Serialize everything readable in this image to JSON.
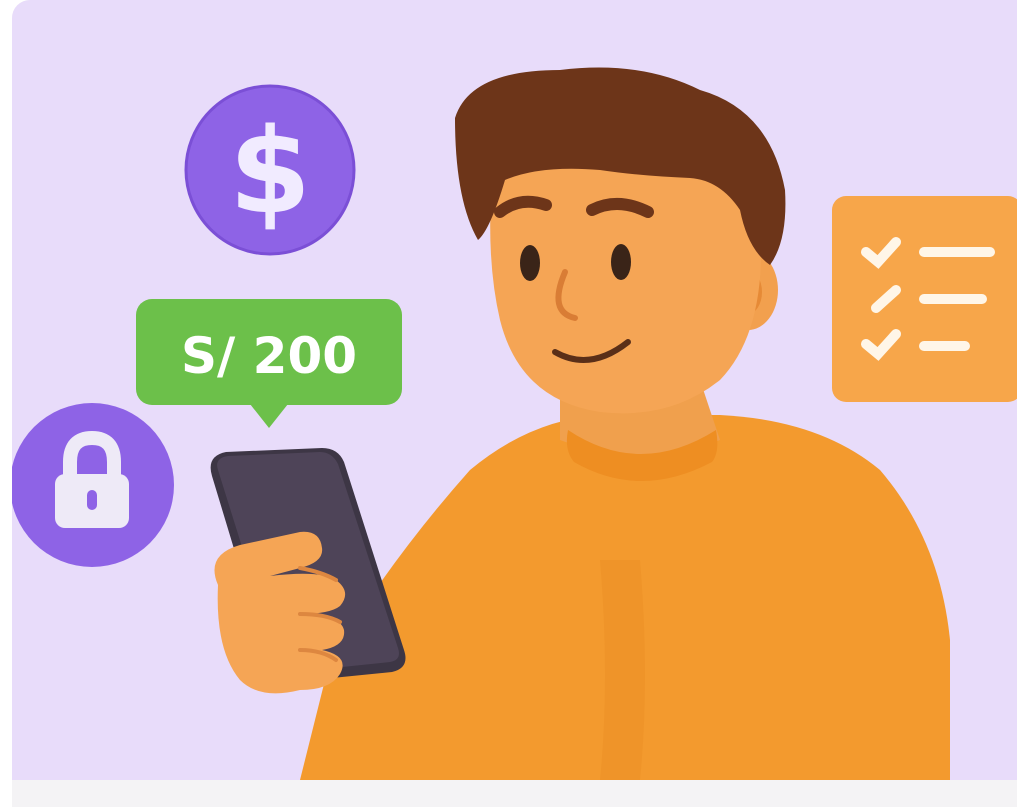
{
  "illustration": {
    "price_tag": {
      "amount": "S/ 200",
      "color": "#6cc04a"
    },
    "dollar_badge": {
      "symbol": "$",
      "color": "#8e63e6"
    },
    "lock_badge": {
      "icon": "lock-icon",
      "color": "#8e63e6"
    },
    "checklist_card": {
      "icon": "checklist-icon",
      "color": "#f7a64a"
    },
    "shirt_color": "#f39a2e",
    "background_color": "#e8dcfa"
  }
}
